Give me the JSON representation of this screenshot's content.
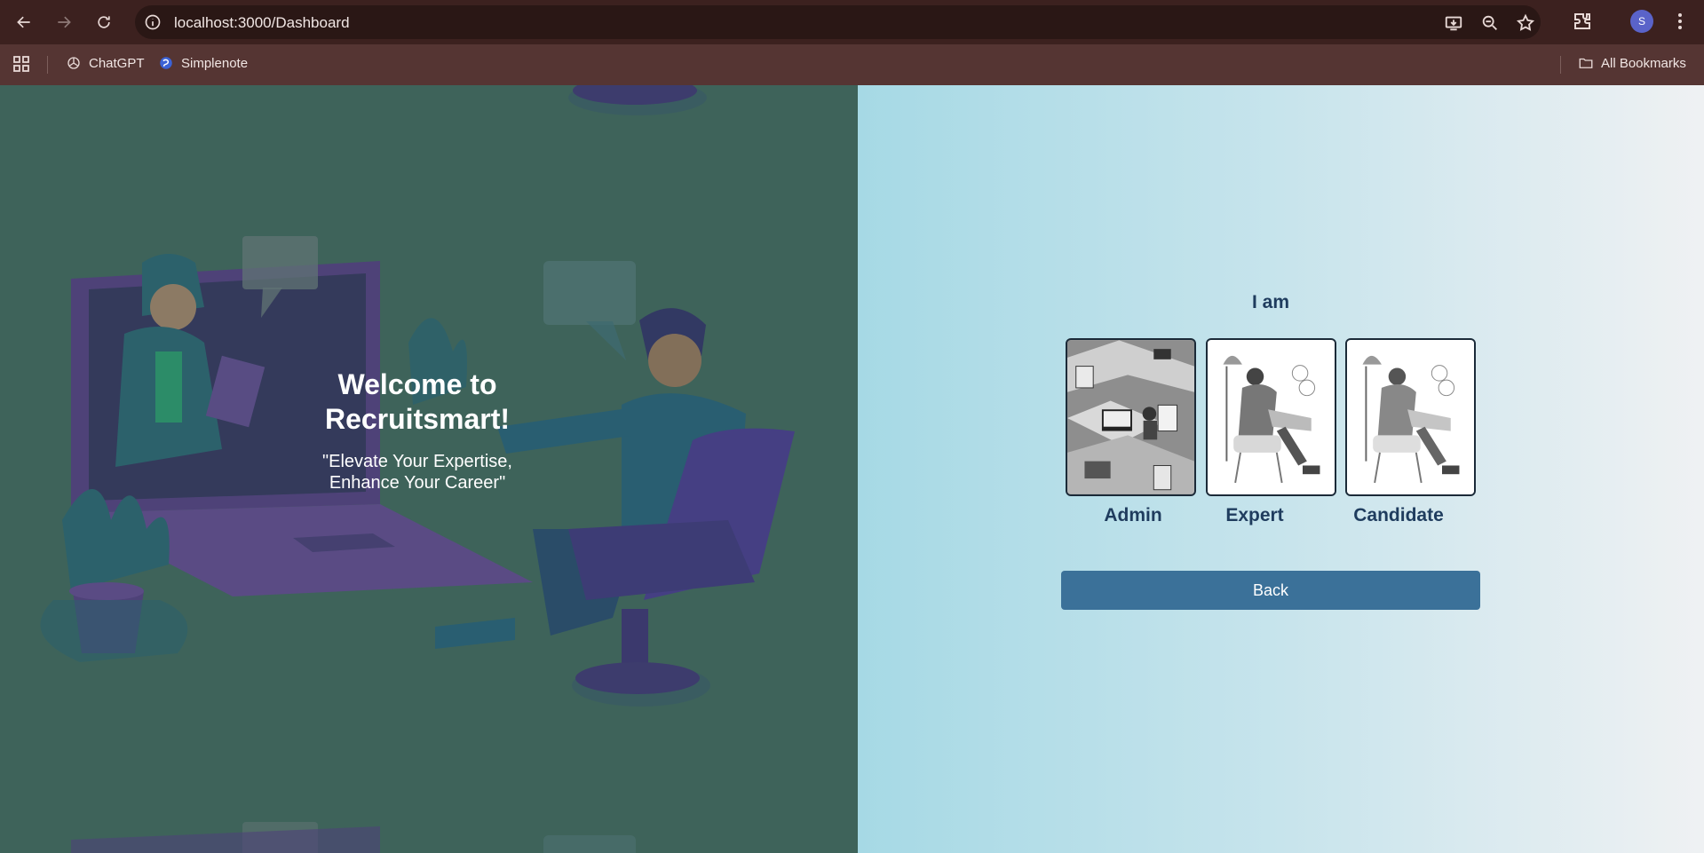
{
  "browser": {
    "url": "localhost:3000/Dashboard",
    "bookmarks": [
      {
        "label": "ChatGPT",
        "icon": "chatgpt-icon"
      },
      {
        "label": "Simplenote",
        "icon": "simplenote-icon"
      }
    ],
    "all_bookmarks": "All Bookmarks",
    "profile_initial": "S"
  },
  "hero": {
    "title": "Welcome to Recruitsmart!",
    "tagline": "\"Elevate Your Expertise, Enhance Your Career\""
  },
  "role_select": {
    "heading": "I am",
    "roles": [
      {
        "label": "Admin",
        "image": "admin-illustration"
      },
      {
        "label": "Expert",
        "image": "expert-illustration"
      },
      {
        "label": "Candidate",
        "image": "candidate-illustration"
      }
    ],
    "back_label": "Back"
  },
  "colors": {
    "chrome_dark": "#3c211f",
    "bookmarks_bar": "#553533",
    "left_panel": "#3f635b",
    "accent_button": "#3b7199",
    "heading_text": "#1f3c5e"
  }
}
